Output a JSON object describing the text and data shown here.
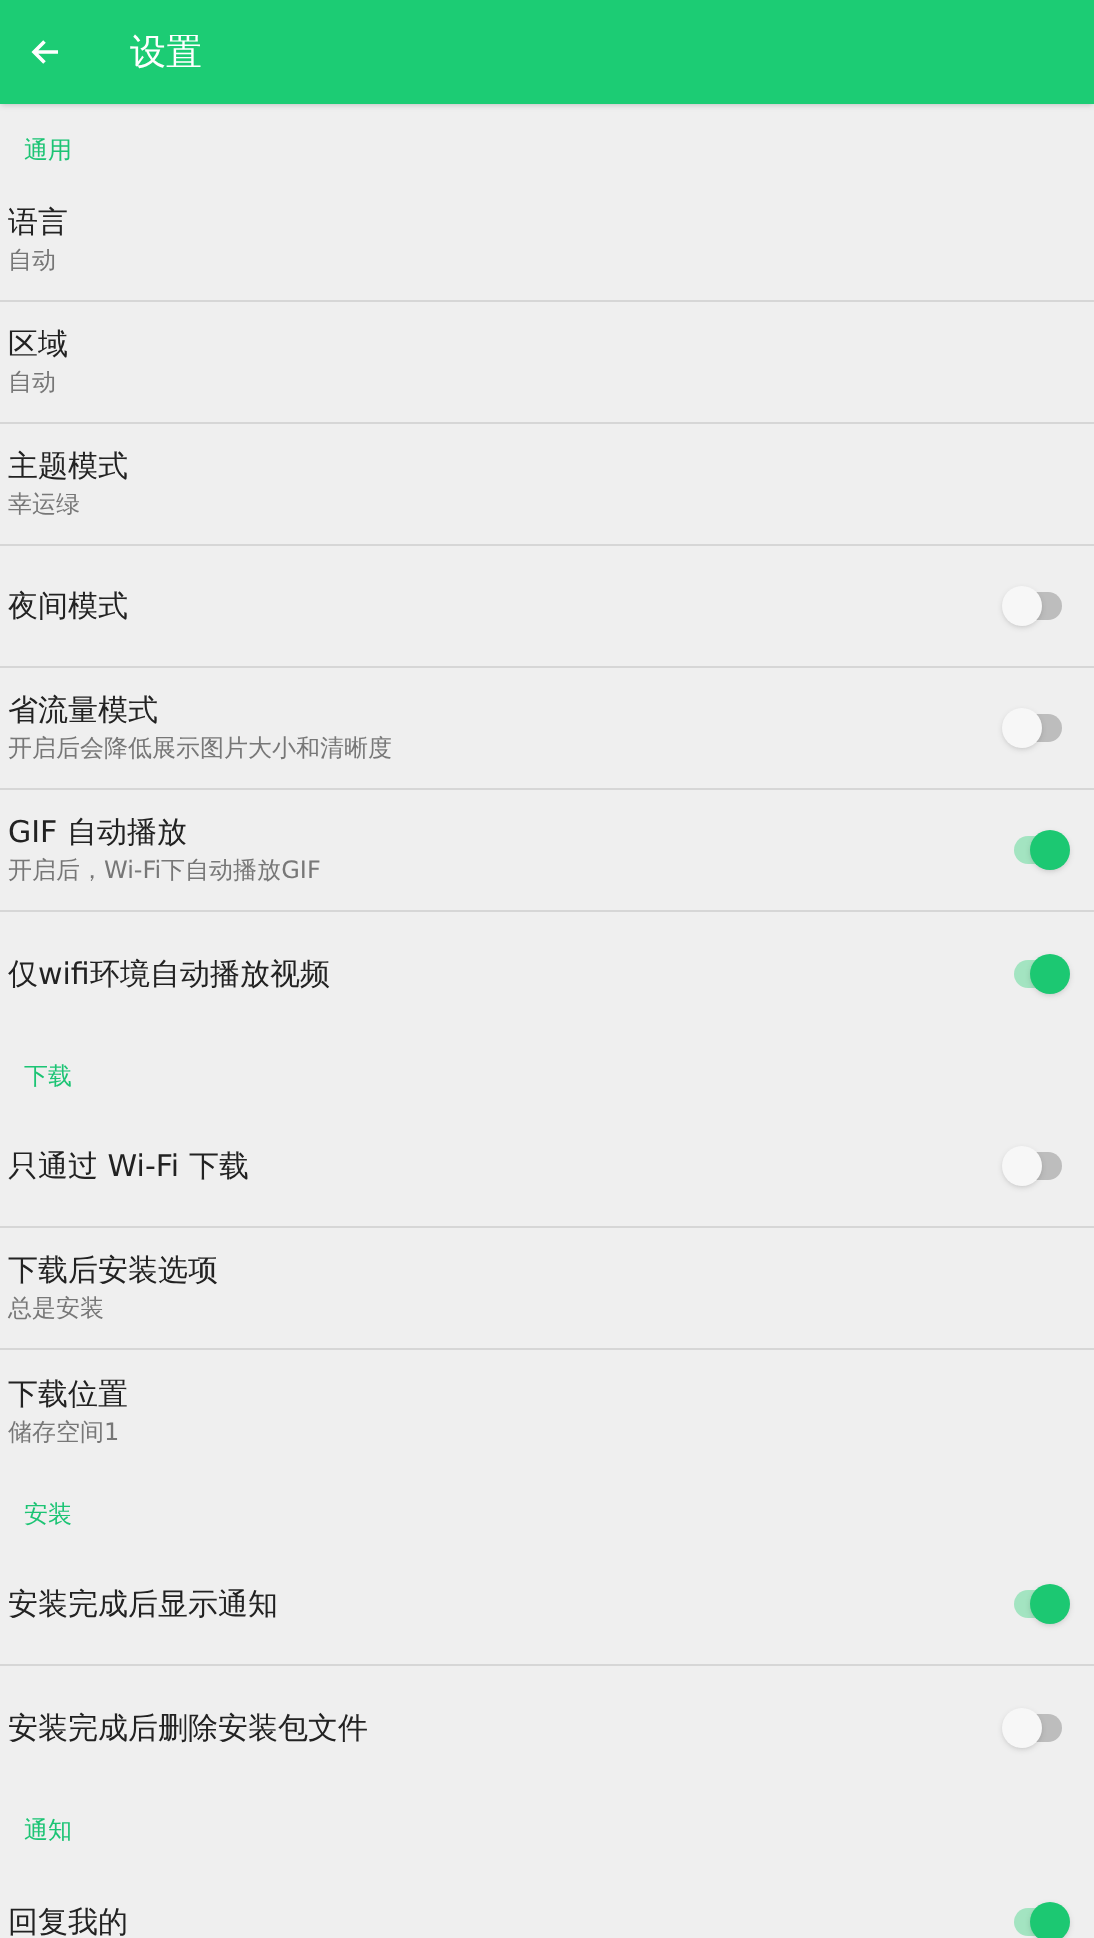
{
  "app_bar": {
    "title": "设置"
  },
  "sections": [
    {
      "title": "通用",
      "items": [
        {
          "kind": "text",
          "label": "语言",
          "summary": "自动"
        },
        {
          "kind": "text",
          "label": "区域",
          "summary": "自动"
        },
        {
          "kind": "text",
          "label": "主题模式",
          "summary": "幸运绿"
        },
        {
          "kind": "switch",
          "label": "夜间模式",
          "on": false
        },
        {
          "kind": "switch",
          "label": "省流量模式",
          "summary": "开启后会降低展示图片大小和清晰度",
          "on": false
        },
        {
          "kind": "switch",
          "label": "GIF 自动播放",
          "summary": "开启后，Wi-Fi下自动播放GIF",
          "on": true
        },
        {
          "kind": "switch",
          "label": "仅wifi环境自动播放视频",
          "on": true
        }
      ]
    },
    {
      "title": "下载",
      "items": [
        {
          "kind": "switch",
          "label": "只通过 Wi-Fi 下载",
          "on": false
        },
        {
          "kind": "text",
          "label": "下载后安装选项",
          "summary": "总是安装"
        },
        {
          "kind": "text",
          "label": "下载位置",
          "summary": "储存空间1"
        }
      ]
    },
    {
      "title": "安装",
      "items": [
        {
          "kind": "switch",
          "label": "安装完成后显示通知",
          "on": true
        },
        {
          "kind": "switch",
          "label": "安装完成后删除安装包文件",
          "on": false
        }
      ]
    },
    {
      "title": "通知",
      "items": [
        {
          "kind": "switch",
          "label": "回复我的",
          "on": true
        }
      ]
    }
  ]
}
